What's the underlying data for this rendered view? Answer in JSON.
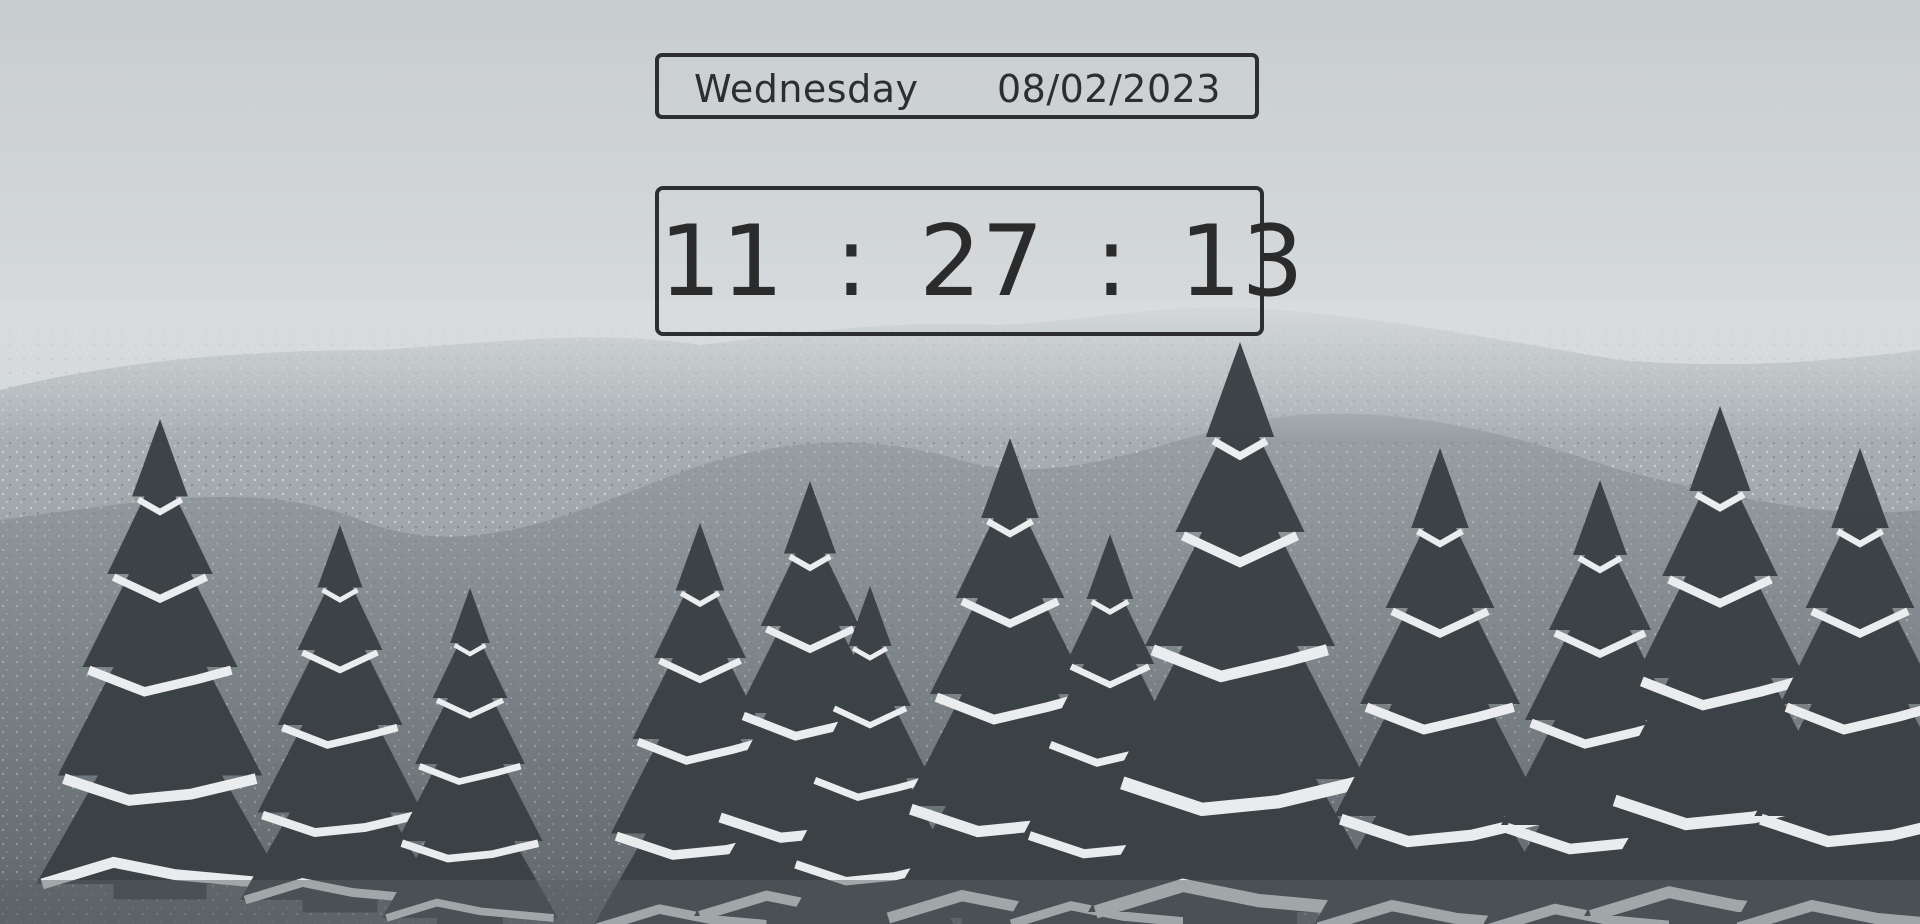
{
  "date": {
    "day": "Wednesday",
    "value": "08/02/2023"
  },
  "time": {
    "hours": "11",
    "minutes": "27",
    "seconds": "13",
    "separator": ":"
  },
  "background": {
    "scene": "snowy-forest-mountain",
    "sky_color": "#d4d8db",
    "forest_color": "#7a8287",
    "tree_color": "#3c4246",
    "snow_color": "#eef0f1"
  }
}
